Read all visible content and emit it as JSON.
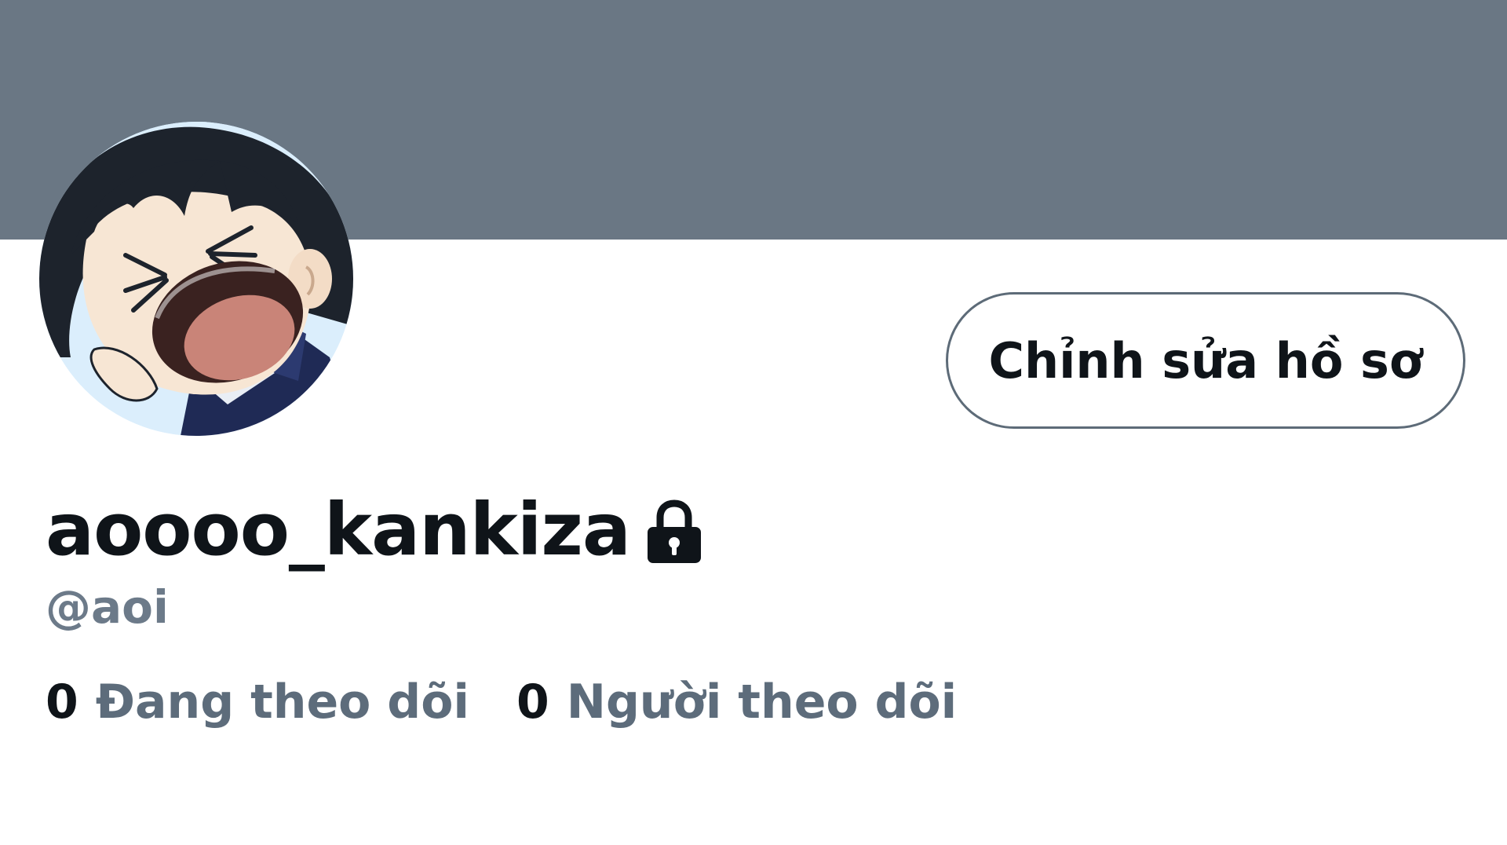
{
  "profile": {
    "display_name": "aoooo_kankiza",
    "handle": "@aoi",
    "protected_icon": "lock-icon",
    "avatar_icon": "anime-character-avatar"
  },
  "actions": {
    "edit_profile_label": "Chỉnh sửa hồ sơ"
  },
  "stats": {
    "following_count": "0",
    "following_label": "Đang theo dõi",
    "followers_count": "0",
    "followers_label": "Người theo dõi"
  },
  "colors": {
    "banner": "#6a7784",
    "text_primary": "#0f1419",
    "text_secondary": "#6c7a89",
    "button_border": "#5d6b78"
  }
}
